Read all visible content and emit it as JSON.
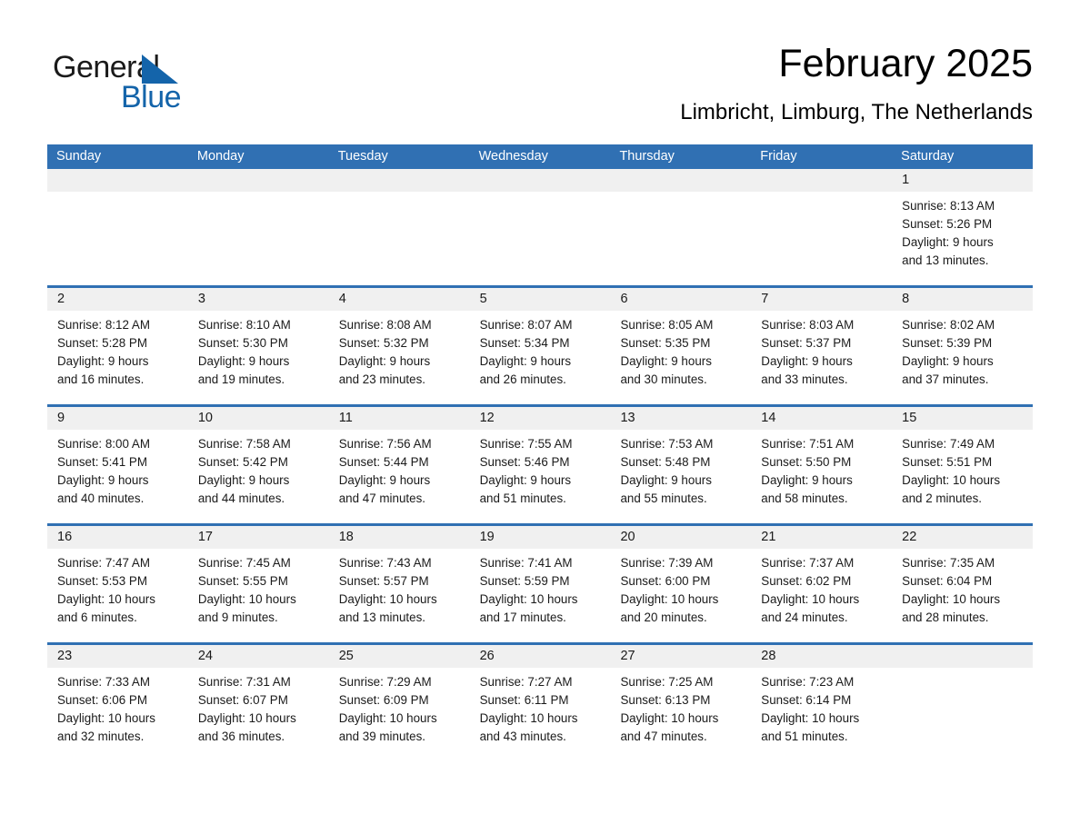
{
  "brand": {
    "line1": "General",
    "line2": "Blue",
    "triangle_icon": "brand-triangle-icon",
    "accent_color": "#1464aa"
  },
  "header": {
    "title": "February 2025",
    "subtitle": "Limbricht, Limburg, The Netherlands"
  },
  "theme": {
    "header_bar": "#3070b3",
    "daynum_band": "#f0f0f0",
    "row_separator": "#3070b3"
  },
  "weekday_headers": [
    "Sunday",
    "Monday",
    "Tuesday",
    "Wednesday",
    "Thursday",
    "Friday",
    "Saturday"
  ],
  "weeks": [
    [
      {
        "day": "",
        "sunrise": "",
        "sunset": "",
        "daylight1": "",
        "daylight2": ""
      },
      {
        "day": "",
        "sunrise": "",
        "sunset": "",
        "daylight1": "",
        "daylight2": ""
      },
      {
        "day": "",
        "sunrise": "",
        "sunset": "",
        "daylight1": "",
        "daylight2": ""
      },
      {
        "day": "",
        "sunrise": "",
        "sunset": "",
        "daylight1": "",
        "daylight2": ""
      },
      {
        "day": "",
        "sunrise": "",
        "sunset": "",
        "daylight1": "",
        "daylight2": ""
      },
      {
        "day": "",
        "sunrise": "",
        "sunset": "",
        "daylight1": "",
        "daylight2": ""
      },
      {
        "day": "1",
        "sunrise": "Sunrise: 8:13 AM",
        "sunset": "Sunset: 5:26 PM",
        "daylight1": "Daylight: 9 hours",
        "daylight2": "and 13 minutes."
      }
    ],
    [
      {
        "day": "2",
        "sunrise": "Sunrise: 8:12 AM",
        "sunset": "Sunset: 5:28 PM",
        "daylight1": "Daylight: 9 hours",
        "daylight2": "and 16 minutes."
      },
      {
        "day": "3",
        "sunrise": "Sunrise: 8:10 AM",
        "sunset": "Sunset: 5:30 PM",
        "daylight1": "Daylight: 9 hours",
        "daylight2": "and 19 minutes."
      },
      {
        "day": "4",
        "sunrise": "Sunrise: 8:08 AM",
        "sunset": "Sunset: 5:32 PM",
        "daylight1": "Daylight: 9 hours",
        "daylight2": "and 23 minutes."
      },
      {
        "day": "5",
        "sunrise": "Sunrise: 8:07 AM",
        "sunset": "Sunset: 5:34 PM",
        "daylight1": "Daylight: 9 hours",
        "daylight2": "and 26 minutes."
      },
      {
        "day": "6",
        "sunrise": "Sunrise: 8:05 AM",
        "sunset": "Sunset: 5:35 PM",
        "daylight1": "Daylight: 9 hours",
        "daylight2": "and 30 minutes."
      },
      {
        "day": "7",
        "sunrise": "Sunrise: 8:03 AM",
        "sunset": "Sunset: 5:37 PM",
        "daylight1": "Daylight: 9 hours",
        "daylight2": "and 33 minutes."
      },
      {
        "day": "8",
        "sunrise": "Sunrise: 8:02 AM",
        "sunset": "Sunset: 5:39 PM",
        "daylight1": "Daylight: 9 hours",
        "daylight2": "and 37 minutes."
      }
    ],
    [
      {
        "day": "9",
        "sunrise": "Sunrise: 8:00 AM",
        "sunset": "Sunset: 5:41 PM",
        "daylight1": "Daylight: 9 hours",
        "daylight2": "and 40 minutes."
      },
      {
        "day": "10",
        "sunrise": "Sunrise: 7:58 AM",
        "sunset": "Sunset: 5:42 PM",
        "daylight1": "Daylight: 9 hours",
        "daylight2": "and 44 minutes."
      },
      {
        "day": "11",
        "sunrise": "Sunrise: 7:56 AM",
        "sunset": "Sunset: 5:44 PM",
        "daylight1": "Daylight: 9 hours",
        "daylight2": "and 47 minutes."
      },
      {
        "day": "12",
        "sunrise": "Sunrise: 7:55 AM",
        "sunset": "Sunset: 5:46 PM",
        "daylight1": "Daylight: 9 hours",
        "daylight2": "and 51 minutes."
      },
      {
        "day": "13",
        "sunrise": "Sunrise: 7:53 AM",
        "sunset": "Sunset: 5:48 PM",
        "daylight1": "Daylight: 9 hours",
        "daylight2": "and 55 minutes."
      },
      {
        "day": "14",
        "sunrise": "Sunrise: 7:51 AM",
        "sunset": "Sunset: 5:50 PM",
        "daylight1": "Daylight: 9 hours",
        "daylight2": "and 58 minutes."
      },
      {
        "day": "15",
        "sunrise": "Sunrise: 7:49 AM",
        "sunset": "Sunset: 5:51 PM",
        "daylight1": "Daylight: 10 hours",
        "daylight2": "and 2 minutes."
      }
    ],
    [
      {
        "day": "16",
        "sunrise": "Sunrise: 7:47 AM",
        "sunset": "Sunset: 5:53 PM",
        "daylight1": "Daylight: 10 hours",
        "daylight2": "and 6 minutes."
      },
      {
        "day": "17",
        "sunrise": "Sunrise: 7:45 AM",
        "sunset": "Sunset: 5:55 PM",
        "daylight1": "Daylight: 10 hours",
        "daylight2": "and 9 minutes."
      },
      {
        "day": "18",
        "sunrise": "Sunrise: 7:43 AM",
        "sunset": "Sunset: 5:57 PM",
        "daylight1": "Daylight: 10 hours",
        "daylight2": "and 13 minutes."
      },
      {
        "day": "19",
        "sunrise": "Sunrise: 7:41 AM",
        "sunset": "Sunset: 5:59 PM",
        "daylight1": "Daylight: 10 hours",
        "daylight2": "and 17 minutes."
      },
      {
        "day": "20",
        "sunrise": "Sunrise: 7:39 AM",
        "sunset": "Sunset: 6:00 PM",
        "daylight1": "Daylight: 10 hours",
        "daylight2": "and 20 minutes."
      },
      {
        "day": "21",
        "sunrise": "Sunrise: 7:37 AM",
        "sunset": "Sunset: 6:02 PM",
        "daylight1": "Daylight: 10 hours",
        "daylight2": "and 24 minutes."
      },
      {
        "day": "22",
        "sunrise": "Sunrise: 7:35 AM",
        "sunset": "Sunset: 6:04 PM",
        "daylight1": "Daylight: 10 hours",
        "daylight2": "and 28 minutes."
      }
    ],
    [
      {
        "day": "23",
        "sunrise": "Sunrise: 7:33 AM",
        "sunset": "Sunset: 6:06 PM",
        "daylight1": "Daylight: 10 hours",
        "daylight2": "and 32 minutes."
      },
      {
        "day": "24",
        "sunrise": "Sunrise: 7:31 AM",
        "sunset": "Sunset: 6:07 PM",
        "daylight1": "Daylight: 10 hours",
        "daylight2": "and 36 minutes."
      },
      {
        "day": "25",
        "sunrise": "Sunrise: 7:29 AM",
        "sunset": "Sunset: 6:09 PM",
        "daylight1": "Daylight: 10 hours",
        "daylight2": "and 39 minutes."
      },
      {
        "day": "26",
        "sunrise": "Sunrise: 7:27 AM",
        "sunset": "Sunset: 6:11 PM",
        "daylight1": "Daylight: 10 hours",
        "daylight2": "and 43 minutes."
      },
      {
        "day": "27",
        "sunrise": "Sunrise: 7:25 AM",
        "sunset": "Sunset: 6:13 PM",
        "daylight1": "Daylight: 10 hours",
        "daylight2": "and 47 minutes."
      },
      {
        "day": "28",
        "sunrise": "Sunrise: 7:23 AM",
        "sunset": "Sunset: 6:14 PM",
        "daylight1": "Daylight: 10 hours",
        "daylight2": "and 51 minutes."
      },
      {
        "day": "",
        "sunrise": "",
        "sunset": "",
        "daylight1": "",
        "daylight2": ""
      }
    ]
  ]
}
